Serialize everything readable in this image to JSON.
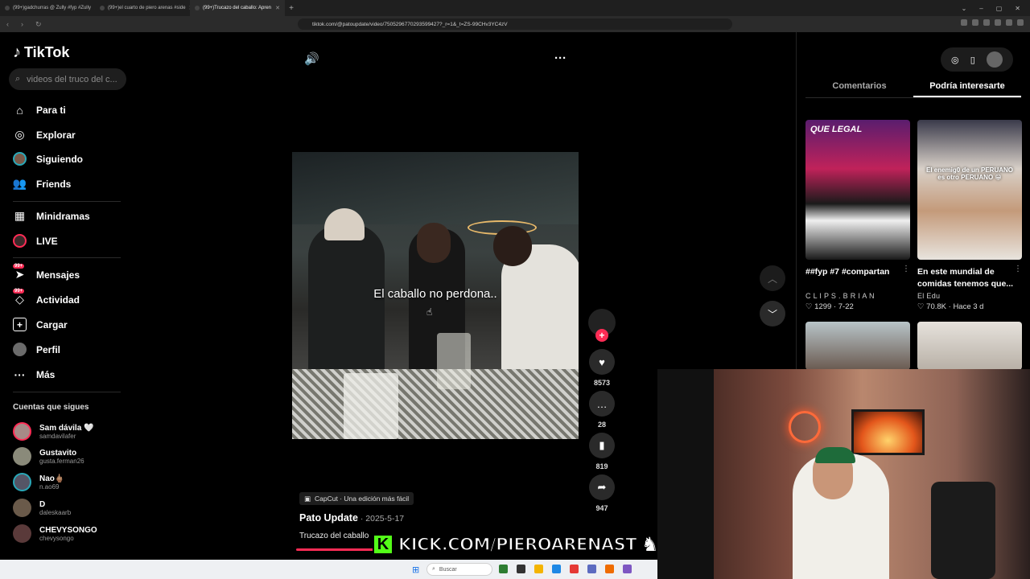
{
  "browser": {
    "tabs": [
      {
        "label": "(99+)gadchurras @ Zully #fyp #Zully"
      },
      {
        "label": "(99+)el cuarto de piero arenas #side"
      },
      {
        "label": "(99+)Trucazo del caballo: Apren"
      }
    ],
    "new_tab": "+",
    "url": "tiktok.com/@patoupdate/video/7505296770293599427?_r=1&_t=ZS-99CHv3YC4zV",
    "window_controls": [
      "⌄",
      "–",
      "▢",
      "✕"
    ]
  },
  "sidebar": {
    "logo": "TikTok",
    "search_placeholder": "videos del truco del c...",
    "menu": [
      {
        "label": "Para ti",
        "icon": "home-icon"
      },
      {
        "label": "Explorar",
        "icon": "compass-icon"
      },
      {
        "label": "Siguiendo",
        "icon": "following-avatar-icon"
      },
      {
        "label": "Friends",
        "icon": "friends-icon"
      },
      {
        "label": "Minidramas",
        "icon": "film-icon"
      },
      {
        "label": "LIVE",
        "icon": "live-icon"
      },
      {
        "label": "Mensajes",
        "icon": "messages-icon",
        "badge": "99+"
      },
      {
        "label": "Actividad",
        "icon": "activity-icon",
        "badge": "99+"
      },
      {
        "label": "Cargar",
        "icon": "upload-icon"
      },
      {
        "label": "Perfil",
        "icon": "profile-icon"
      },
      {
        "label": "Más",
        "icon": "more-icon"
      }
    ],
    "following_title": "Cuentas que sigues",
    "following": [
      {
        "name": "Sam dávila 🤍",
        "handle": "samdavilafer"
      },
      {
        "name": "Gustavito",
        "handle": "gusta.ferman26"
      },
      {
        "name": "Nao🖕🏽",
        "handle": "n.ao69"
      },
      {
        "name": "D",
        "handle": "daleskaarb"
      },
      {
        "name": "CHEVYSONGO",
        "handle": "chevysongo"
      }
    ]
  },
  "video": {
    "caption": "El caballo no perdona..",
    "capcut_label": "CapCut · Una edición más fácil",
    "author": "Pato Update",
    "date": " · 2025-5-17",
    "description": "Trucazo del caballo",
    "progress": 0.25,
    "actions": [
      {
        "icon": "heart-icon",
        "count": "8573"
      },
      {
        "icon": "comment-icon",
        "count": "28"
      },
      {
        "icon": "bookmark-icon",
        "count": "819"
      },
      {
        "icon": "share-icon",
        "count": "947"
      }
    ]
  },
  "right_panel": {
    "tabs": [
      "Comentarios",
      "Podría interesarte"
    ],
    "selected_tab": "Podría interesarte",
    "cards": [
      {
        "title": "##fyp #7 #compartan",
        "channel": "C L I P S . B R I A N",
        "likes": "1299",
        "date": "7-22",
        "thumb_text": "QUE LEGAL"
      },
      {
        "title": "En este mundial de comidas tenemos que...",
        "channel": "El Edu",
        "likes": "70.8K",
        "date": "Hace 3 d",
        "thumb_text": "El enemig0 de un PERUANO es otro PERUANO 😁"
      }
    ]
  },
  "overlay": {
    "kick_logo": "K",
    "kick_text": "KICK.COM/PIEROARENAST"
  },
  "taskbar": {
    "search_label": "Buscar"
  }
}
